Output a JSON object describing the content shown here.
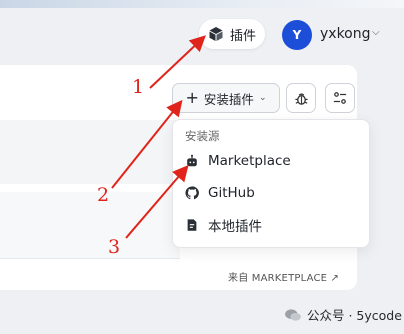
{
  "header": {
    "plugin_label": "插件",
    "avatar_letter": "Y",
    "username": "yxkong"
  },
  "toolbar": {
    "install_label": "安装插件"
  },
  "dropdown": {
    "header": "安装源",
    "items": [
      {
        "label": "Marketplace",
        "icon": "robot-icon"
      },
      {
        "label": "GitHub",
        "icon": "github-icon"
      },
      {
        "label": "本地插件",
        "icon": "file-plugin-icon"
      }
    ]
  },
  "footer_link": "来自 MARKETPLACE ↗",
  "watermark": "公众号 · 5ycode",
  "annotations": [
    "1",
    "2",
    "3"
  ],
  "colors": {
    "accent": "#1d4ed8",
    "annotation": "#e0241b",
    "background": "#eef0f4"
  }
}
